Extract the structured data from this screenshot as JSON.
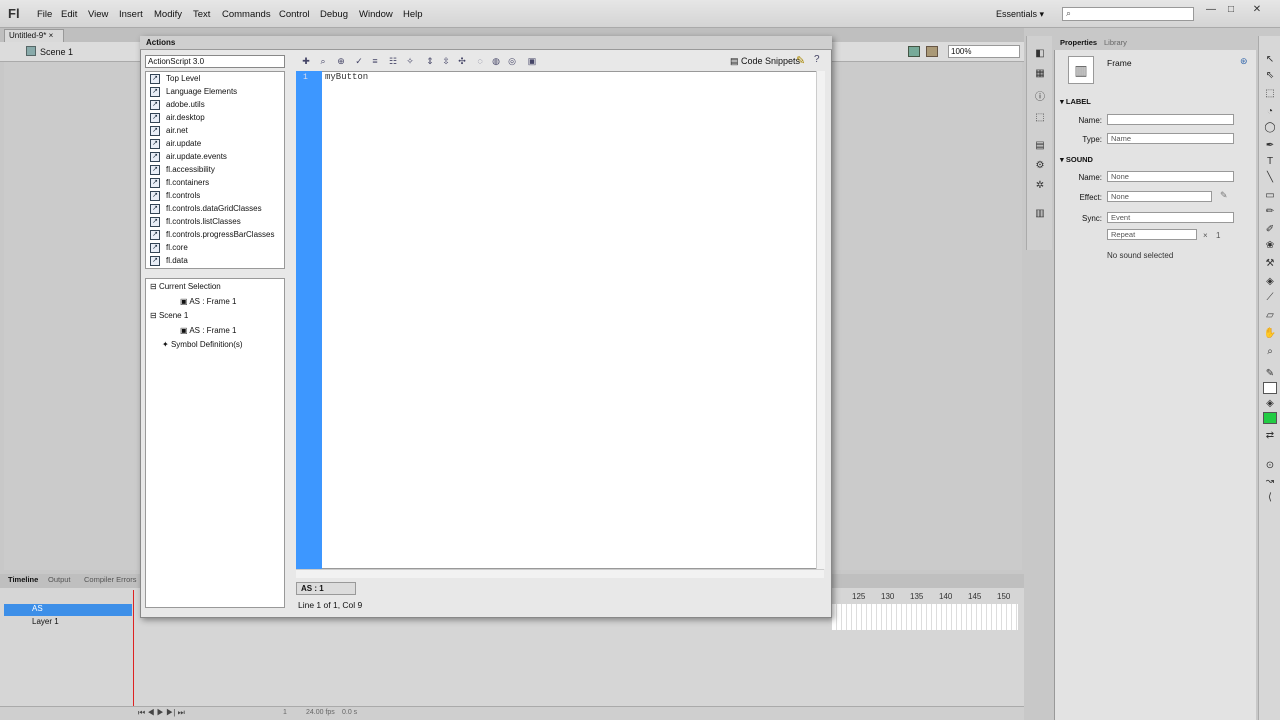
{
  "app": {
    "logo": "Fl",
    "workspace": "Essentials ▾",
    "window_controls": [
      "—",
      "□",
      "✕"
    ]
  },
  "menu": [
    "File",
    "Edit",
    "View",
    "Insert",
    "Modify",
    "Text",
    "Commands",
    "Control",
    "Debug",
    "Window",
    "Help"
  ],
  "document": {
    "tab": "Untitled-9*",
    "close": "×",
    "scene": "Scene 1",
    "zoom": "100%"
  },
  "actions": {
    "title": "Actions",
    "language": "ActionScript 3.0",
    "toolbox": [
      "Top Level",
      "Language Elements",
      "adobe.utils",
      "air.desktop",
      "air.net",
      "air.update",
      "air.update.events",
      "fl.accessibility",
      "fl.containers",
      "fl.controls",
      "fl.controls.dataGridClasses",
      "fl.controls.listClasses",
      "fl.controls.progressBarClasses",
      "fl.core",
      "fl.data"
    ],
    "tree": {
      "current_selection": "Current Selection",
      "current_frame": "AS : Frame 1",
      "scene": "Scene 1",
      "scene_frame": "AS : Frame 1",
      "symbols": "Symbol Definition(s)"
    },
    "code_snippets": "Code Snippets",
    "line_number": "1",
    "code": "myButton",
    "script_tab": "AS : 1",
    "status": "Line 1 of 1, Col 9"
  },
  "timeline": {
    "tabs": [
      "Timeline",
      "Output",
      "Compiler Errors"
    ],
    "layers": [
      "AS",
      "Layer 1"
    ],
    "frame_numbers": [
      "125",
      "130",
      "135",
      "140",
      "145",
      "150"
    ],
    "current_frame": "1",
    "fps": "24.00 fps",
    "elapsed": "0.0 s"
  },
  "properties": {
    "tabs": [
      "Properties",
      "Library"
    ],
    "type": "Frame",
    "label_section": "LABEL",
    "name_label": "Name:",
    "name_value": "",
    "type_label": "Type:",
    "type_value": "Name",
    "sound_section": "SOUND",
    "sound_name_label": "Name:",
    "sound_name_value": "None",
    "effect_label": "Effect:",
    "effect_value": "None",
    "sync_label": "Sync:",
    "sync_value": "Event",
    "repeat_value": "Repeat",
    "repeat_count": "1",
    "no_sound": "No sound selected"
  }
}
